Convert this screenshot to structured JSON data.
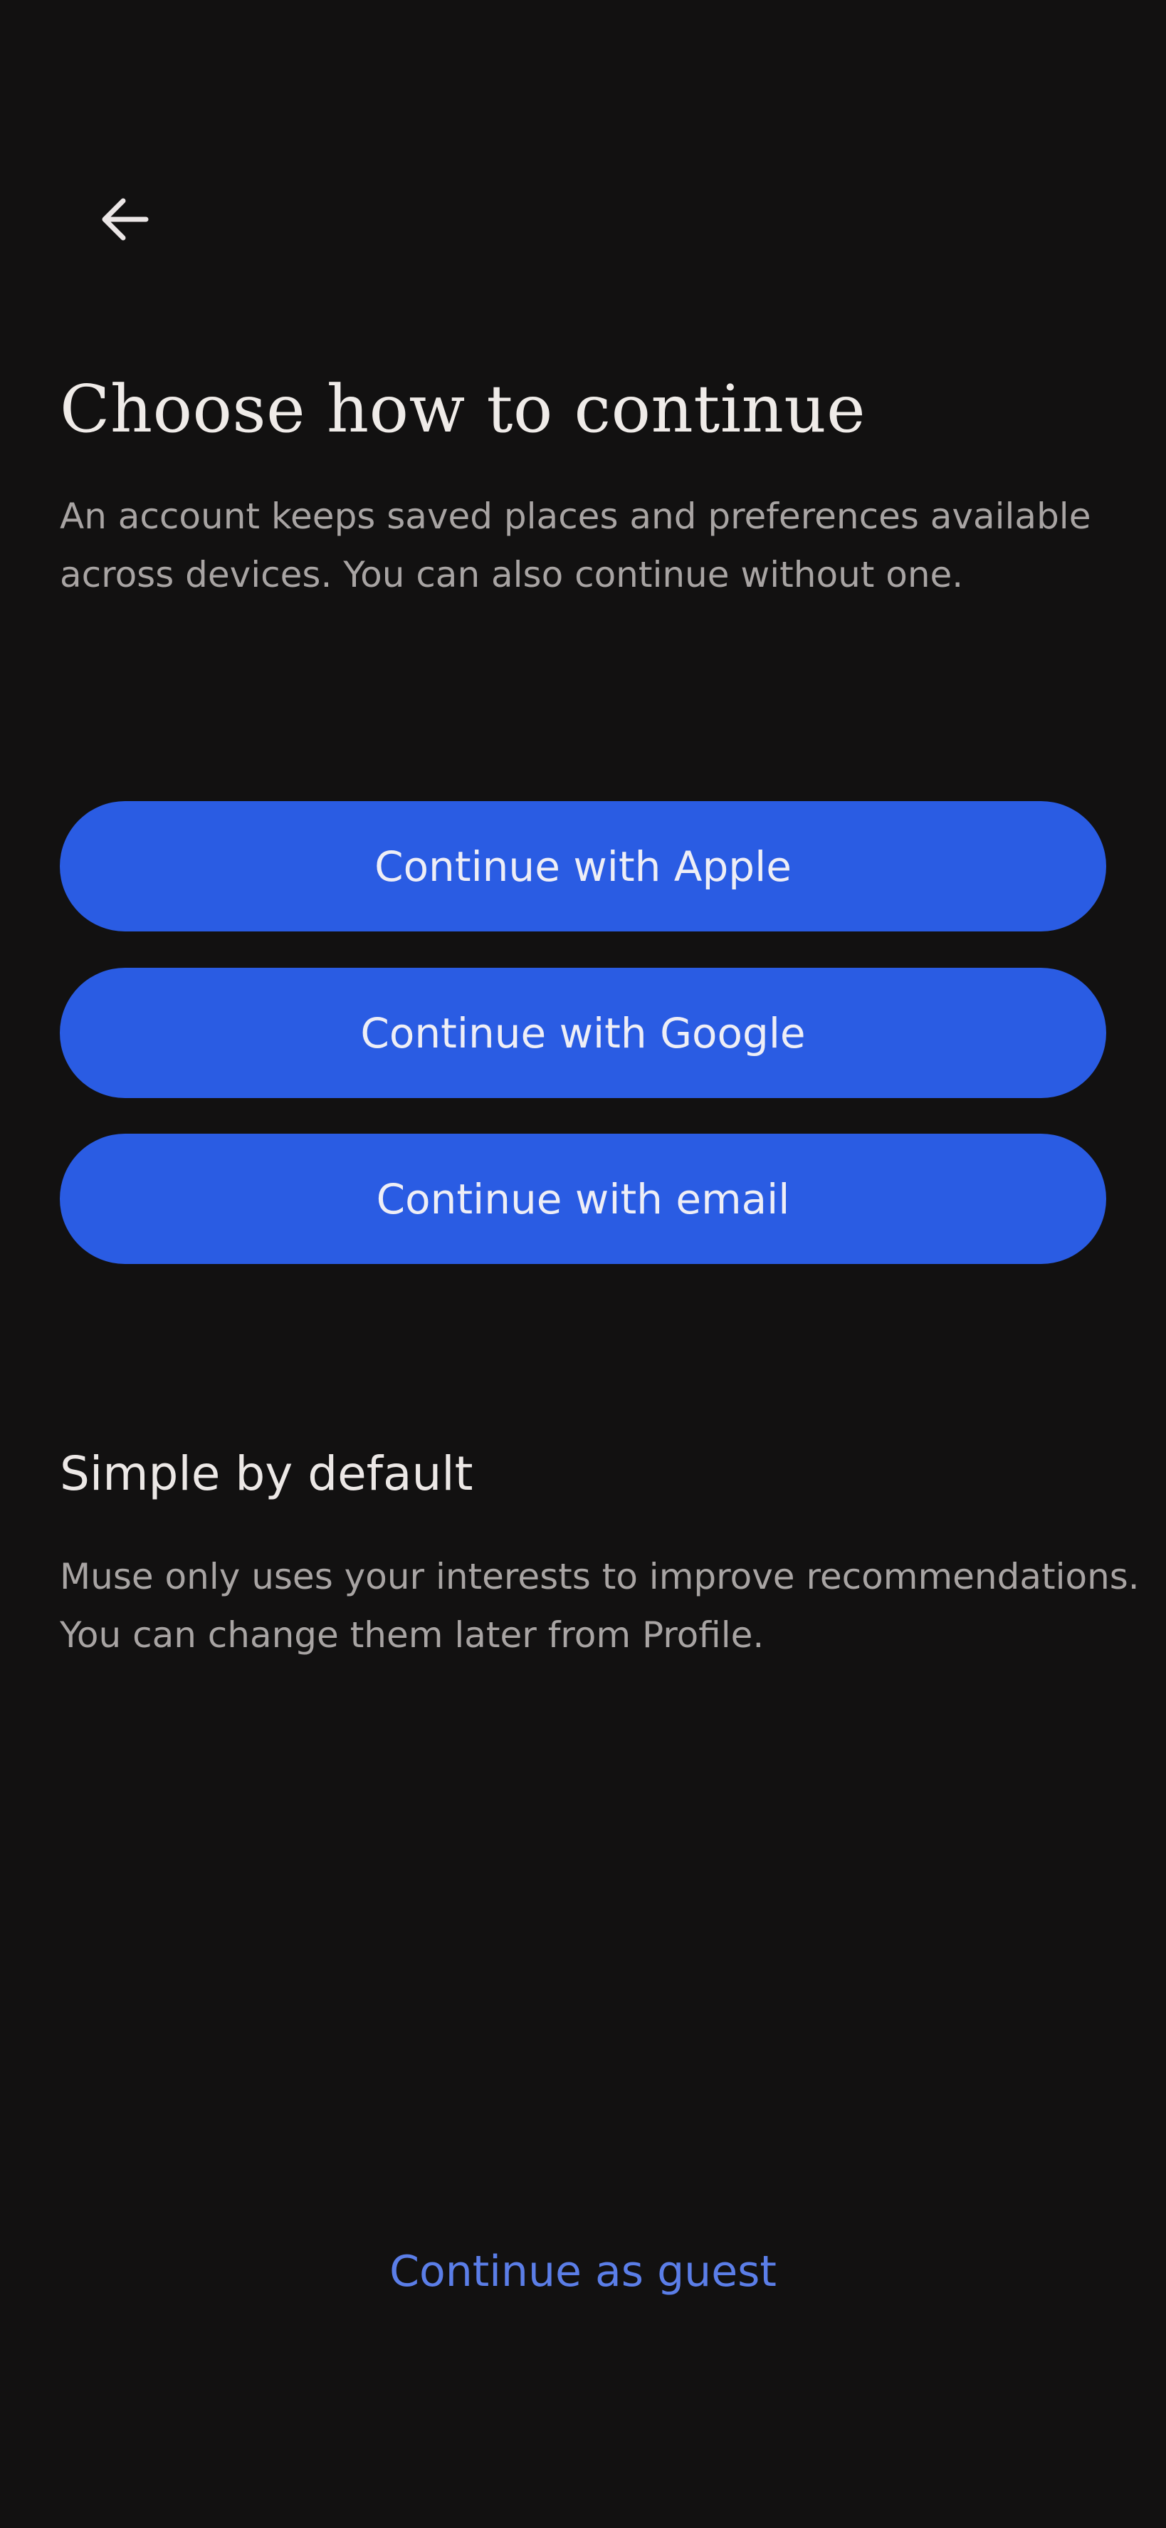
{
  "header": {
    "back_icon": "arrow-left-icon"
  },
  "intro": {
    "title": "Choose how to continue",
    "subtitle": "An account keeps saved places and preferences available across devices. You can also continue without one."
  },
  "auth_options": {
    "apple_label": "Continue with Apple",
    "google_label": "Continue with Google",
    "email_label": "Continue with email"
  },
  "privacy": {
    "title": "Simple by default",
    "body": "Muse only uses your interests to improve recommendations. You can change them later from Profile."
  },
  "footer": {
    "guest_label": "Continue as guest"
  },
  "colors": {
    "background": "#121111",
    "primary_button": "#2a5ce3",
    "link": "#5b7ee8",
    "text_primary": "#ebe6e6",
    "text_secondary": "#a8a4a3"
  }
}
